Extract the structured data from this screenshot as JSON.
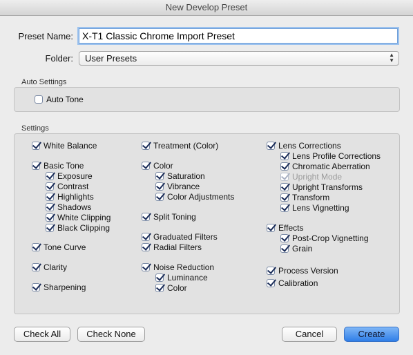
{
  "window": {
    "title": "New Develop Preset"
  },
  "preset_name": {
    "label": "Preset Name:",
    "value": "X-T1 Classic Chrome Import Preset"
  },
  "folder": {
    "label": "Folder:",
    "value": "User Presets"
  },
  "auto_settings": {
    "title": "Auto Settings",
    "auto_tone": {
      "label": "Auto Tone",
      "checked": false
    }
  },
  "settings": {
    "title": "Settings",
    "items": [
      {
        "name": "white-balance",
        "label": "White Balance",
        "checked": true
      },
      {
        "name": "basic-tone",
        "label": "Basic Tone",
        "checked": true
      },
      {
        "name": "exposure",
        "label": "Exposure",
        "checked": true
      },
      {
        "name": "contrast",
        "label": "Contrast",
        "checked": true
      },
      {
        "name": "highlights",
        "label": "Highlights",
        "checked": true
      },
      {
        "name": "shadows",
        "label": "Shadows",
        "checked": true
      },
      {
        "name": "white-clipping",
        "label": "White Clipping",
        "checked": true
      },
      {
        "name": "black-clipping",
        "label": "Black Clipping",
        "checked": true
      },
      {
        "name": "tone-curve",
        "label": "Tone Curve",
        "checked": true
      },
      {
        "name": "clarity",
        "label": "Clarity",
        "checked": true
      },
      {
        "name": "sharpening",
        "label": "Sharpening",
        "checked": true
      },
      {
        "name": "treatment-color",
        "label": "Treatment (Color)",
        "checked": true
      },
      {
        "name": "color",
        "label": "Color",
        "checked": true
      },
      {
        "name": "saturation",
        "label": "Saturation",
        "checked": true
      },
      {
        "name": "vibrance",
        "label": "Vibrance",
        "checked": true
      },
      {
        "name": "color-adjustments",
        "label": "Color Adjustments",
        "checked": true
      },
      {
        "name": "split-toning",
        "label": "Split Toning",
        "checked": true
      },
      {
        "name": "graduated-filters",
        "label": "Graduated Filters",
        "checked": true
      },
      {
        "name": "radial-filters",
        "label": "Radial Filters",
        "checked": true
      },
      {
        "name": "noise-reduction",
        "label": "Noise Reduction",
        "checked": true
      },
      {
        "name": "luminance",
        "label": "Luminance",
        "checked": true
      },
      {
        "name": "nr-color",
        "label": "Color",
        "checked": true
      },
      {
        "name": "lens-corrections",
        "label": "Lens Corrections",
        "checked": true
      },
      {
        "name": "lens-profile-corrections",
        "label": "Lens Profile Corrections",
        "checked": true
      },
      {
        "name": "chromatic-aberration",
        "label": "Chromatic Aberration",
        "checked": true
      },
      {
        "name": "upright-mode",
        "label": "Upright Mode",
        "checked": true,
        "disabled": true
      },
      {
        "name": "upright-transforms",
        "label": "Upright Transforms",
        "checked": true
      },
      {
        "name": "transform",
        "label": "Transform",
        "checked": true
      },
      {
        "name": "lens-vignetting",
        "label": "Lens Vignetting",
        "checked": true
      },
      {
        "name": "effects",
        "label": "Effects",
        "checked": true
      },
      {
        "name": "post-crop-vignetting",
        "label": "Post-Crop Vignetting",
        "checked": true
      },
      {
        "name": "grain",
        "label": "Grain",
        "checked": true
      },
      {
        "name": "process-version",
        "label": "Process Version",
        "checked": true
      },
      {
        "name": "calibration",
        "label": "Calibration",
        "checked": true
      }
    ]
  },
  "buttons": {
    "check_all": "Check All",
    "check_none": "Check None",
    "cancel": "Cancel",
    "create": "Create"
  }
}
